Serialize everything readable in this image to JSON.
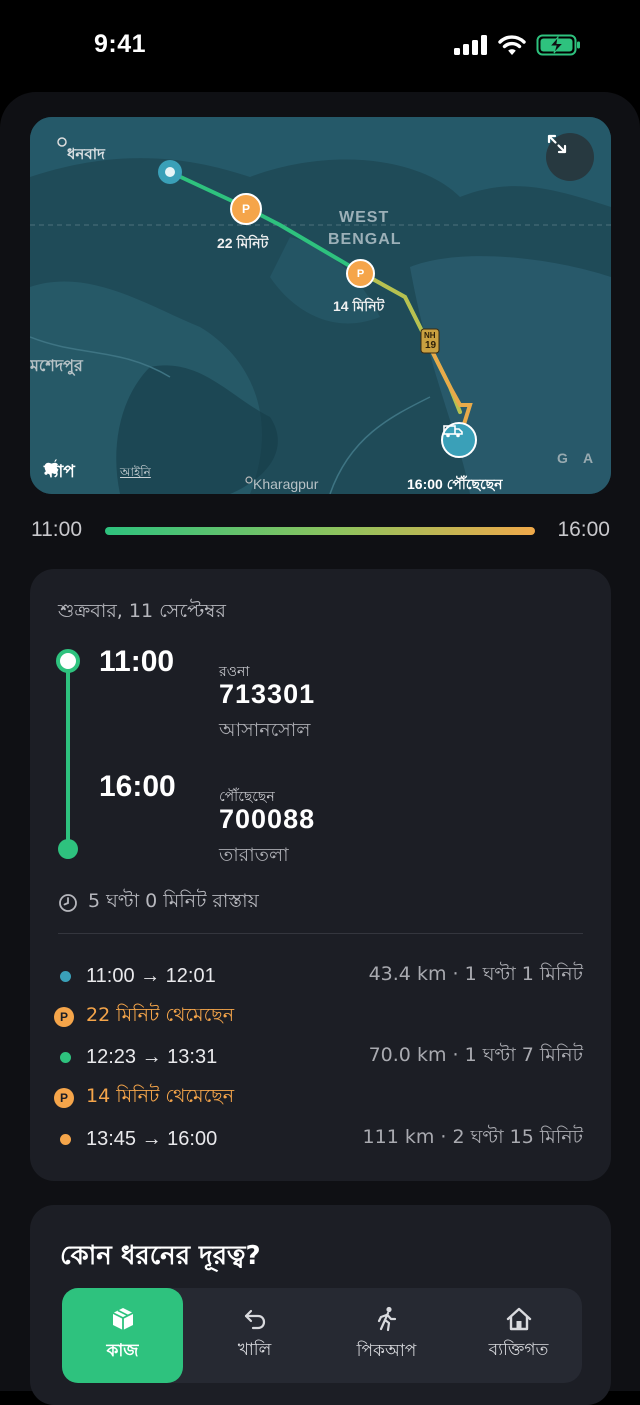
{
  "status_bar": {
    "time": "9:41"
  },
  "map": {
    "places": {
      "dhanbad": "ধনবাদ",
      "jamshedpur": "মশেদপুর",
      "west": "WEST",
      "bengal": "BENGAL",
      "kharagpur": "Kharagpur",
      "nh": "NH",
      "nh_num": "19",
      "edge_g": "G",
      "edge_a": "A"
    },
    "stop1_label": "22 মিনিট",
    "stop2_label": "14 মিনিট",
    "arrival_label": "16:00 পৌঁছেছেন",
    "brand": "ম্যাপ",
    "legal": "আইনি"
  },
  "timeline_bar": {
    "start": "11:00",
    "end": "16:00"
  },
  "trip": {
    "date": "শুক্রবার, 11 সেপ্টেম্বর",
    "departure": {
      "time": "11:00",
      "label": "রওনা",
      "code": "713301",
      "place": "আসানসোল"
    },
    "arrival": {
      "time": "16:00",
      "label": "পৌঁছেছেন",
      "code": "700088",
      "place": "তারাতলা"
    },
    "duration": "5 ঘণ্টা 0 মিনিট রাস্তায়",
    "segments": [
      {
        "times": "11:00 → 12:01",
        "info": "43.4 km · 1 ঘণ্টা 1 মিনিট",
        "color": "#3aa0b8"
      },
      {
        "times": "12:23 → 13:31",
        "info": "70.0 km · 1 ঘণ্টা 7 মিনিট",
        "color": "#2ec27e"
      },
      {
        "times": "13:45 → 16:00",
        "info": "111 km · 2 ঘণ্টা 15 মিনিট",
        "color": "#f5a54a"
      }
    ],
    "stops": [
      {
        "badge": "P",
        "text": "22 মিনিট থেমেছেন"
      },
      {
        "badge": "P",
        "text": "14 মিনিট থেমেছেন"
      }
    ]
  },
  "distance_type": {
    "title": "কোন ধরনের দূরত্ব?",
    "options": [
      {
        "label": "কাজ",
        "icon": "box-icon",
        "active": true
      },
      {
        "label": "খালি",
        "icon": "return-arrow-icon",
        "active": false
      },
      {
        "label": "পিকআপ",
        "icon": "walking-person-icon",
        "active": false
      },
      {
        "label": "ব্যক্তিগত",
        "icon": "home-icon",
        "active": false
      }
    ]
  },
  "colors": {
    "accent": "#2ec27e",
    "stop": "#f5a54a",
    "card": "#1c1e25"
  }
}
